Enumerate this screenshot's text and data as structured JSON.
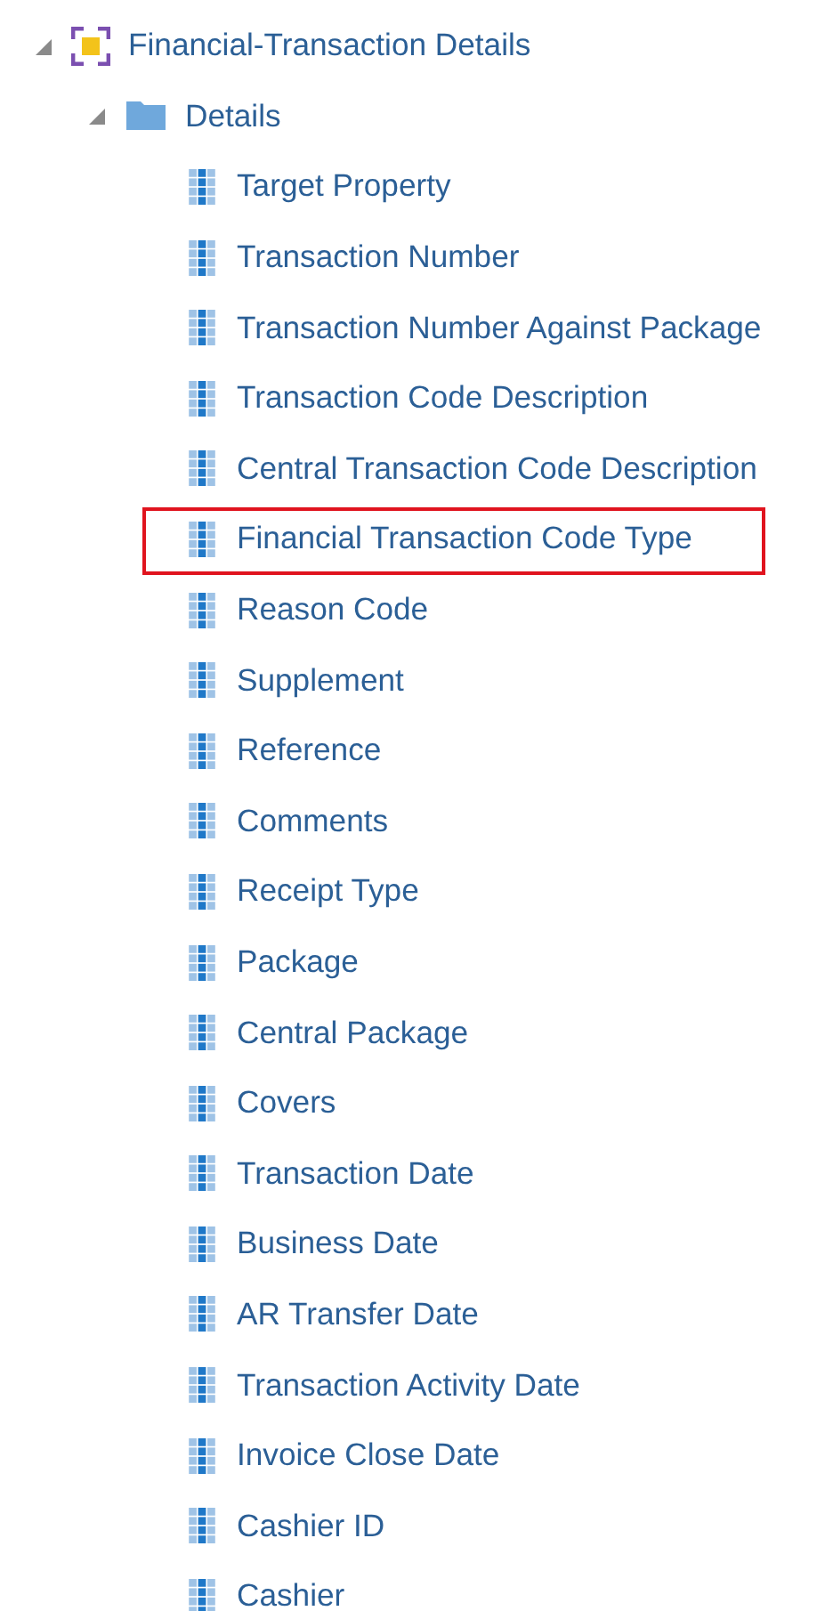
{
  "tree": {
    "label": "Financial-Transaction Details",
    "expanded": true,
    "children": [
      {
        "label": "Details",
        "expanded": true,
        "children": [
          {
            "label": "Target Property",
            "highlighted": false
          },
          {
            "label": "Transaction Number",
            "highlighted": false
          },
          {
            "label": "Transaction Number Against Package",
            "highlighted": false
          },
          {
            "label": "Transaction Code Description",
            "highlighted": false
          },
          {
            "label": "Central Transaction Code Description",
            "highlighted": false
          },
          {
            "label": "Financial Transaction Code Type",
            "highlighted": true
          },
          {
            "label": "Reason Code",
            "highlighted": false
          },
          {
            "label": "Supplement",
            "highlighted": false
          },
          {
            "label": "Reference",
            "highlighted": false
          },
          {
            "label": "Comments",
            "highlighted": false
          },
          {
            "label": "Receipt Type",
            "highlighted": false
          },
          {
            "label": "Package",
            "highlighted": false
          },
          {
            "label": "Central Package",
            "highlighted": false
          },
          {
            "label": "Covers",
            "highlighted": false
          },
          {
            "label": "Transaction Date",
            "highlighted": false
          },
          {
            "label": "Business Date",
            "highlighted": false
          },
          {
            "label": "AR Transfer Date",
            "highlighted": false
          },
          {
            "label": "Transaction Activity Date",
            "highlighted": false
          },
          {
            "label": "Invoice Close Date",
            "highlighted": false
          },
          {
            "label": "Cashier ID",
            "highlighted": false
          },
          {
            "label": "Cashier",
            "highlighted": false
          }
        ]
      }
    ]
  }
}
